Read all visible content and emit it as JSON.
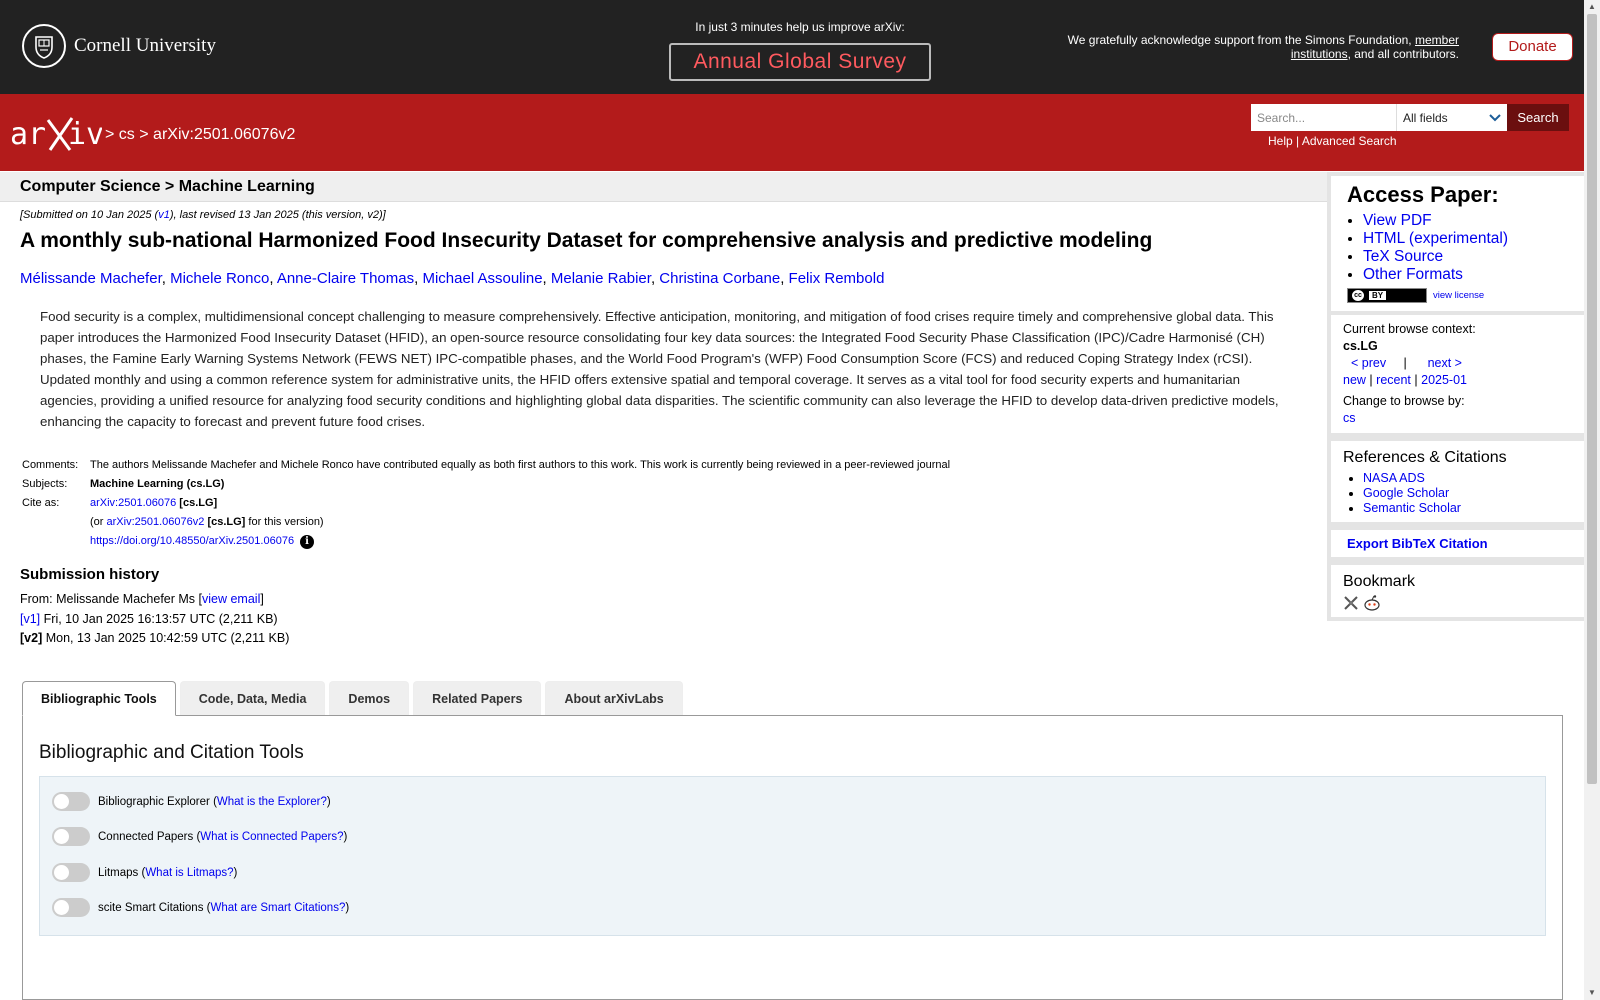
{
  "banner": {
    "institution": "Cornell University",
    "survey_message": "In just 3 minutes help us improve arXiv:",
    "survey_button": "Annual Global Survey",
    "ack_text": "We gratefully acknowledge support from the Simons Foundation,",
    "ack_link": "member institutions",
    "ack_end": ", and all contributors.",
    "donate": "Donate"
  },
  "header": {
    "sep1": ">",
    "crumb_cs": "cs",
    "sep2": ">",
    "crumb_id": "arXiv:2501.06076v2",
    "search_placeholder": "Search...",
    "search_field": "All fields",
    "search_button": "Search",
    "help": "Help",
    "help_sep": "|",
    "advanced": "Advanced Search"
  },
  "paper": {
    "subject_bar": "Computer Science > Machine Learning",
    "dateline_pre": "[Submitted on 10 Jan 2025 (",
    "dateline_v1": "v1",
    "dateline_post": "), last revised 13 Jan 2025 (this version, v2)]",
    "title": "A monthly sub-national Harmonized Food Insecurity Dataset for comprehensive analysis and predictive modeling",
    "authors": [
      "Mélissande Machefer",
      "Michele Ronco",
      "Anne-Claire Thomas",
      "Michael Assouline",
      "Melanie Rabier",
      "Christina Corbane",
      "Felix Rembold"
    ],
    "abstract": "Food security is a complex, multidimensional concept challenging to measure comprehensively. Effective anticipation, monitoring, and mitigation of food crises require timely and comprehensive global data. This paper introduces the Harmonized Food Insecurity Dataset (HFID), an open-source resource consolidating four key data sources: the Integrated Food Security Phase Classification (IPC)/Cadre Harmonisé (CH) phases, the Famine Early Warning Systems Network (FEWS NET) IPC-compatible phases, and the World Food Program's (WFP) Food Consumption Score (FCS) and reduced Coping Strategy Index (rCSI). Updated monthly and using a common reference system for administrative units, the HFID offers extensive spatial and temporal coverage. It serves as a vital tool for food security experts and humanitarian agencies, providing a unified resource for analyzing food security conditions and highlighting global data disparities. The scientific community can also leverage the HFID to develop data-driven predictive models, enhancing the capacity to forecast and prevent future food crises.",
    "comments_label": "Comments:",
    "comments": "The authors Melissande Machefer and Michele Ronco have contributed equally as both first authors to this work. This work is currently being reviewed in a peer-reviewed journal",
    "subjects_label": "Subjects:",
    "subjects": "Machine Learning (cs.LG)",
    "cite_label": "Cite as:",
    "cite_id": "arXiv:2501.06076",
    "cite_cat": "[cs.LG]",
    "cite_or": "(or",
    "cite_v2": "arXiv:2501.06076v2",
    "cite_v2_cat": "[cs.LG]",
    "cite_v2_end": "for this version)",
    "doi": "https://doi.org/10.48550/arXiv.2501.06076",
    "info_glyph": "i"
  },
  "history": {
    "title": "Submission history",
    "from_pre": "From: Melissande Machefer Ms [",
    "view_email": "view email",
    "from_post": "]",
    "v1_label": "[v1]",
    "v1_text": "Fri, 10 Jan 2025 16:13:57 UTC (2,211 KB)",
    "v2_label": "[v2]",
    "v2_text": "Mon, 13 Jan 2025 10:42:59 UTC (2,211 KB)"
  },
  "tabs": [
    "Bibliographic Tools",
    "Code, Data, Media",
    "Demos",
    "Related Papers",
    "About arXivLabs"
  ],
  "panel": {
    "title": "Bibliographic and Citation Tools",
    "tools": [
      {
        "label": "Bibliographic Explorer",
        "link": "What is the Explorer?"
      },
      {
        "label": "Connected Papers",
        "link": "What is Connected Papers?"
      },
      {
        "label": "Litmaps",
        "link": "What is Litmaps?"
      },
      {
        "label": "scite Smart Citations",
        "link": "What are Smart Citations?"
      }
    ]
  },
  "sidebar": {
    "access_title": "Access Paper:",
    "access_links": [
      "View PDF",
      "HTML (experimental)",
      "TeX Source",
      "Other Formats"
    ],
    "cc_label": "BY",
    "view_license": "view license",
    "browse_context_label": "Current browse context:",
    "browse_context": "cs.LG",
    "prev": "< prev",
    "pipe": "|",
    "next": "next >",
    "new": "new",
    "recent": "recent",
    "month": "2025-01",
    "change_browse": "Change to browse by:",
    "browse_cs": "cs",
    "refs_title": "References & Citations",
    "refs": [
      "NASA ADS",
      "Google Scholar",
      "Semantic Scholar"
    ],
    "bibtex": "Export BibTeX Citation",
    "bookmark_title": "Bookmark"
  },
  "colors": {
    "arxiv_red": "#b31b1b",
    "banner_dark": "#222222",
    "link": "#0000ee",
    "survey_text": "#ff5a5f"
  }
}
